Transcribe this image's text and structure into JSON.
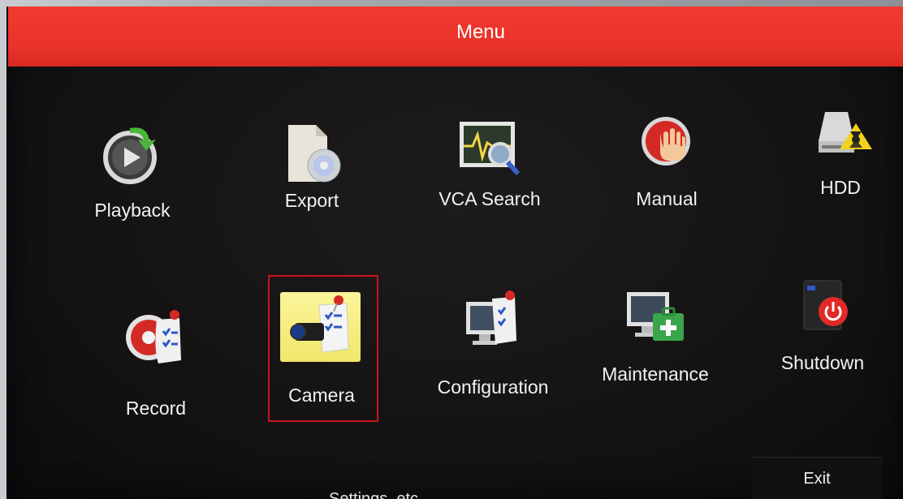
{
  "window": {
    "title": "Menu"
  },
  "menu_items": [
    {
      "label": "Playback",
      "icon": "playback-icon"
    },
    {
      "label": "Export",
      "icon": "export-icon"
    },
    {
      "label": "VCA Search",
      "icon": "vca-search-icon"
    },
    {
      "label": "Manual",
      "icon": "manual-icon"
    },
    {
      "label": "HDD",
      "icon": "hdd-icon"
    },
    {
      "label": "Record",
      "icon": "record-icon"
    },
    {
      "label": "Camera",
      "icon": "camera-icon",
      "selected": true
    },
    {
      "label": "Configuration",
      "icon": "configuration-icon"
    },
    {
      "label": "Maintenance",
      "icon": "maintenance-icon"
    },
    {
      "label": "Shutdown",
      "icon": "shutdown-icon"
    }
  ],
  "footer": {
    "exit_label": "Exit",
    "partial_text": "Settings, etc."
  },
  "colors": {
    "title_bar": "#e8322a",
    "background": "#151314",
    "selection_border": "#c8141b",
    "selection_fill": "#f1e66a"
  }
}
